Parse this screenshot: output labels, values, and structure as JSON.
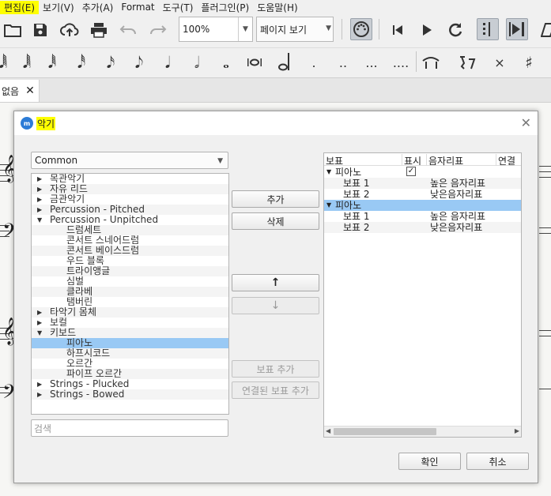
{
  "menu": [
    "편집(E)",
    "보기(V)",
    "추가(A)",
    "Format",
    "도구(T)",
    "플러그인(P)",
    "도움말(H)"
  ],
  "toolbar": {
    "zoom": "100%",
    "view_mode": "페이지 보기"
  },
  "tab": {
    "label": "제목 없음",
    "visible_label": "없음",
    "close": "✕"
  },
  "notes": {
    "dots": [
      ".",
      "..",
      "...",
      "...."
    ],
    "sharp": "♯"
  },
  "dialog": {
    "title": "악기",
    "close": "✕",
    "category": "Common",
    "search_placeholder": "검색",
    "tree": [
      {
        "label": "목관악기",
        "level": 0,
        "expanded": false
      },
      {
        "label": "자유 리드",
        "level": 0,
        "expanded": false
      },
      {
        "label": "금관악기",
        "level": 0,
        "expanded": false
      },
      {
        "label": "Percussion - Pitched",
        "level": 0,
        "expanded": false
      },
      {
        "label": "Percussion - Unpitched",
        "level": 0,
        "expanded": true
      },
      {
        "label": "드럼세트",
        "level": 1
      },
      {
        "label": "콘서트 스네어드럼",
        "level": 1
      },
      {
        "label": "콘서트 베이스드럼",
        "level": 1
      },
      {
        "label": "우드 블록",
        "level": 1
      },
      {
        "label": "트라이앵글",
        "level": 1
      },
      {
        "label": "심벌",
        "level": 1
      },
      {
        "label": "클라베",
        "level": 1
      },
      {
        "label": "탬버린",
        "level": 1
      },
      {
        "label": "타악기 몸체",
        "level": 0,
        "expanded": false
      },
      {
        "label": "보컬",
        "level": 0,
        "expanded": false
      },
      {
        "label": "키보드",
        "level": 0,
        "expanded": true
      },
      {
        "label": "피아노",
        "level": 1,
        "selected": true
      },
      {
        "label": "하프시코드",
        "level": 1
      },
      {
        "label": "오르간",
        "level": 1
      },
      {
        "label": "파이프 오르간",
        "level": 1
      },
      {
        "label": "Strings - Plucked",
        "level": 0,
        "expanded": false
      },
      {
        "label": "Strings - Bowed",
        "level": 0,
        "expanded": false
      }
    ],
    "buttons": {
      "add": "추가",
      "remove": "삭제",
      "up": "↑",
      "down": "↓",
      "add_staff": "보표 추가",
      "add_linked_staff": "연결된 보표 추가",
      "ok": "확인",
      "cancel": "취소"
    },
    "table": {
      "headers": [
        "보표",
        "표시",
        "음자리표",
        "연결"
      ],
      "rows": [
        {
          "name": "피아노",
          "visible": true,
          "clef": "",
          "type": "instrument",
          "selected": false
        },
        {
          "name": "보표 1",
          "clef": "높은 음자리표",
          "type": "staff"
        },
        {
          "name": "보표 2",
          "clef": "낮은음자리표",
          "type": "staff"
        },
        {
          "name": "피아노",
          "visible": false,
          "clef": "",
          "type": "instrument",
          "selected": true
        },
        {
          "name": "보표 1",
          "clef": "높은 음자리표",
          "type": "staff"
        },
        {
          "name": "보표 2",
          "clef": "낮은음자리표",
          "type": "staff"
        }
      ]
    }
  }
}
